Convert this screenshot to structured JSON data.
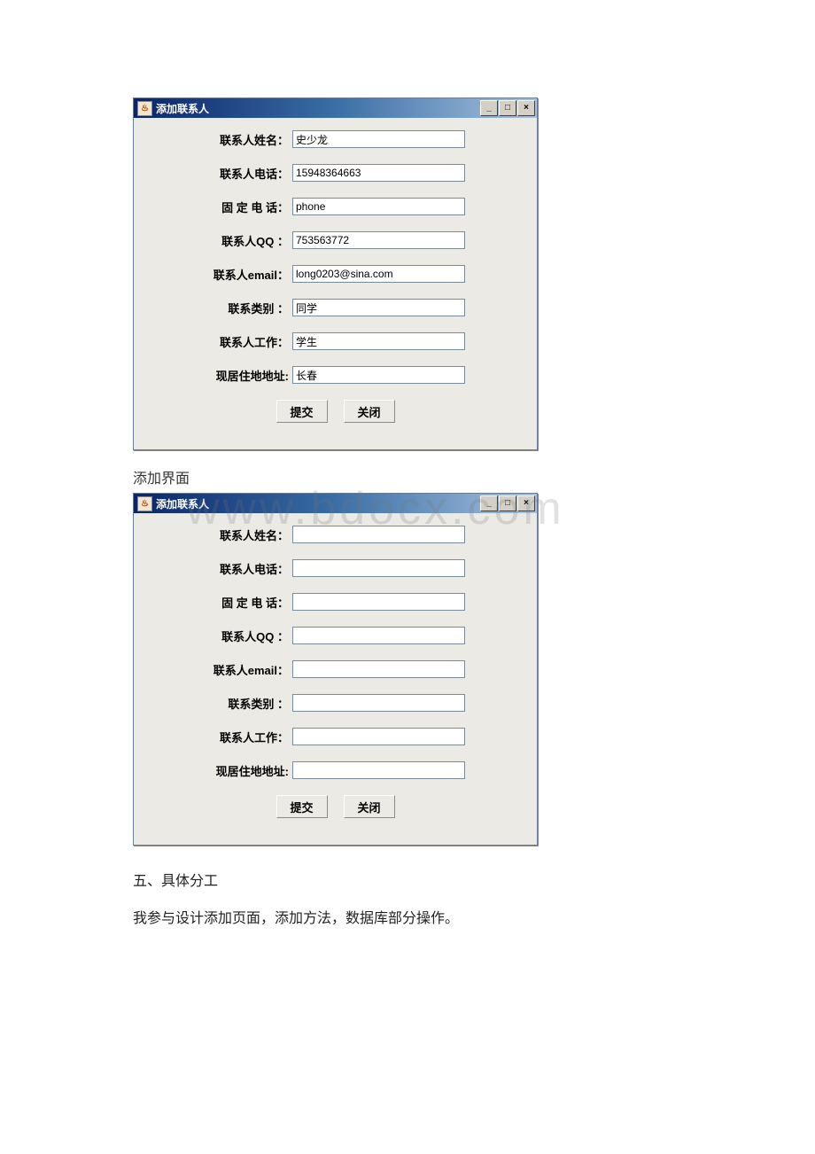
{
  "window1": {
    "title": "添加联系人",
    "controls": {
      "min": "_",
      "max": "□",
      "close": "×"
    },
    "fields": {
      "name": {
        "label": "联系人姓名：",
        "value": "史少龙"
      },
      "mobile": {
        "label": "联系人电话：",
        "value": "15948364663"
      },
      "phone": {
        "label": "固 定 电 话：",
        "value": "phone"
      },
      "qq": {
        "label": "联系人QQ ：",
        "value": "753563772"
      },
      "email": {
        "label": "联系人email：",
        "value": "long0203@sina.com"
      },
      "type": {
        "label": "联系类别 ：",
        "value": "同学"
      },
      "job": {
        "label": "联系人工作：",
        "value": "学生"
      },
      "address": {
        "label": "现居住地地址:",
        "value": "长春"
      }
    },
    "buttons": {
      "submit": "提交",
      "close": "关闭"
    }
  },
  "caption1": "添加界面",
  "watermark": "www.bdocx.com",
  "window2": {
    "title": "添加联系人",
    "controls": {
      "min": "_",
      "max": "□",
      "close": "×"
    },
    "fields": {
      "name": {
        "label": "联系人姓名：",
        "value": ""
      },
      "mobile": {
        "label": "联系人电话：",
        "value": ""
      },
      "phone": {
        "label": "固 定 电 话：",
        "value": ""
      },
      "qq": {
        "label": "联系人QQ ：",
        "value": ""
      },
      "email": {
        "label": "联系人email：",
        "value": ""
      },
      "type": {
        "label": "联系类别 ：",
        "value": ""
      },
      "job": {
        "label": "联系人工作：",
        "value": ""
      },
      "address": {
        "label": "现居住地地址:",
        "value": ""
      }
    },
    "buttons": {
      "submit": "提交",
      "close": "关闭"
    }
  },
  "section_heading": "五、具体分工",
  "body_text": "我参与设计添加页面，添加方法，数据库部分操作。"
}
